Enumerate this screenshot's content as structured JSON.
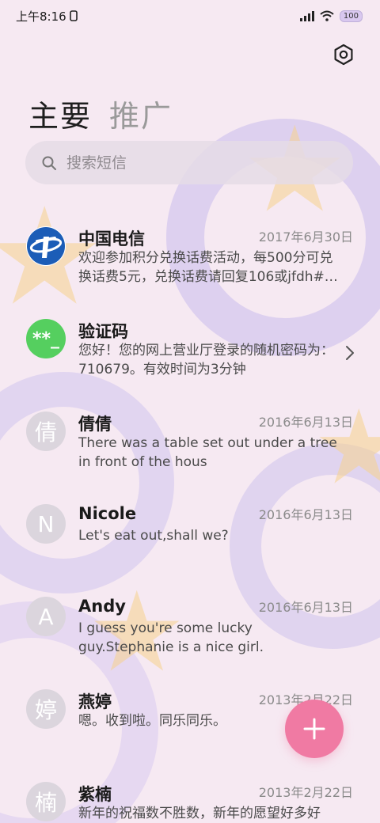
{
  "status": {
    "time": "上午8:16",
    "battery": "100"
  },
  "tabs": [
    {
      "label": "主要"
    },
    {
      "label": "推广"
    }
  ],
  "search": {
    "placeholder": "搜索短信"
  },
  "conversations": [
    {
      "name": "中国电信",
      "date": "2017年6月30日",
      "preview": "欢迎参加积分兑换话费活动，每500分可兑换话费5元，兑换话费请回复106或jfdh#…",
      "avatar": "telecom-logo"
    },
    {
      "name": "验证码",
      "date": "",
      "preview": "您好！您的网上营业厅登录的随机密码为：710679。有效时间为3分钟",
      "avatar_text": "**_"
    },
    {
      "name": "倩倩",
      "date": "2016年6月13日",
      "preview": "There was a table set out under a tree in front of the hous",
      "avatar_text": "倩"
    },
    {
      "name": "Nicole",
      "date": "2016年6月13日",
      "preview": "Let's eat out,shall we?",
      "avatar_text": "N"
    },
    {
      "name": "Andy",
      "date": "2016年6月13日",
      "preview": "I guess you're some lucky guy.Stephanie is a nice girl.",
      "avatar_text": "A"
    },
    {
      "name": "燕婷",
      "date": "2013年2月22日",
      "preview": "嗯。收到啦。同乐同乐。",
      "avatar_text": "婷"
    },
    {
      "name": "紫楠",
      "date": "2013年2月22日",
      "preview": "新年的祝福数不胜数，新年的愿望好多好多，新年的问候依旧美好，在这个温馨的…",
      "avatar_text": "楠"
    }
  ],
  "colors": {
    "accent": "#f07aa3",
    "verify_avatar": "#55cf5f",
    "background": "#f6e9f2"
  }
}
